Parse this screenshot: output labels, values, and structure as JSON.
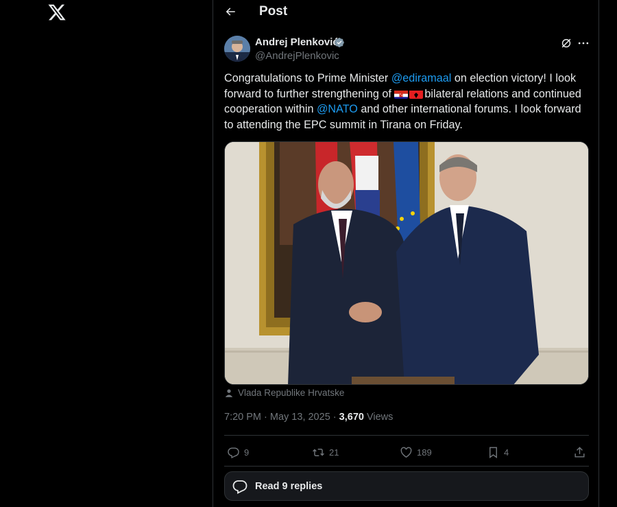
{
  "header": {
    "title": "Post"
  },
  "author": {
    "name": "Andrej Plenković",
    "handle": "@AndrejPlenkovic"
  },
  "tweet": {
    "part1": "Congratulations to Prime Minister ",
    "mention1": "@ediramaal",
    "part2": " on election victory! I look forward to further strengthening of ",
    "part3": "bilateral relations and continued cooperation within ",
    "mention2": "@NATO",
    "part4": " and other international forums. I look forward to attending the EPC summit in Tirana on Friday."
  },
  "media": {
    "credit": "Vlada Republike Hrvatske"
  },
  "meta": {
    "time": "7:20 PM",
    "sep1": " · ",
    "date": "May 13, 2025",
    "sep2": " · ",
    "views": "3,670",
    "views_label": " Views"
  },
  "actions": {
    "replies": "9",
    "reposts": "21",
    "likes": "189",
    "bookmarks": "4"
  },
  "replies_button": {
    "label": "Read 9 replies"
  },
  "colors": {
    "accent": "#1d9bf0",
    "background": "#000000",
    "muted": "#71767b",
    "border": "#2f3336"
  }
}
